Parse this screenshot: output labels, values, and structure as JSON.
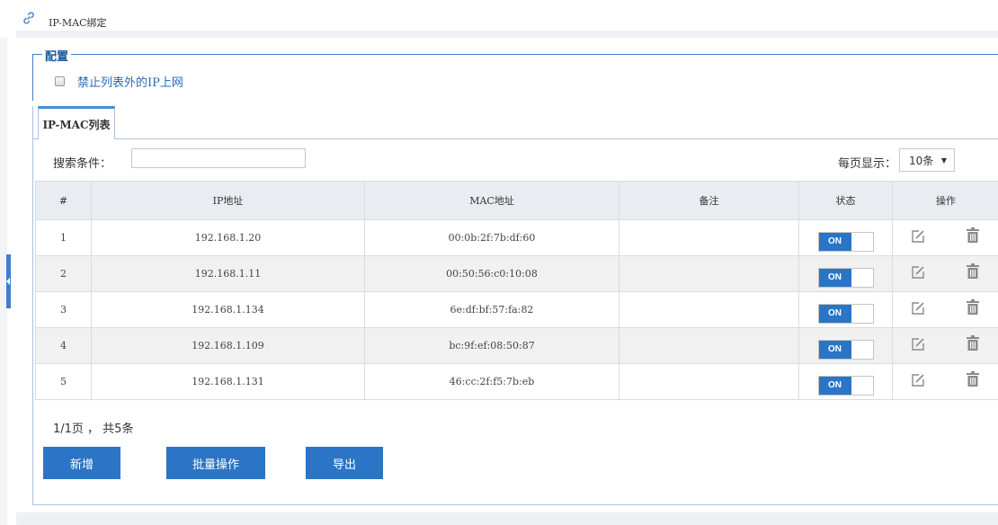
{
  "header": {
    "title": "IP-MAC绑定",
    "icon": "link-icon"
  },
  "config": {
    "legend": "配置",
    "checkbox_label": "禁止列表外的IP上网",
    "checked": false
  },
  "tab": {
    "label": "IP-MAC列表"
  },
  "search": {
    "label": "搜索条件：",
    "value": ""
  },
  "per_page": {
    "label": "每页显示：",
    "selected": "10条"
  },
  "table": {
    "headers": [
      "#",
      "IP地址",
      "MAC地址",
      "备注",
      "状态",
      "操作"
    ],
    "rows": [
      {
        "index": "1",
        "ip": "192.168.1.20",
        "mac": "00:0b:2f:7b:df:60",
        "note": "",
        "status": "ON"
      },
      {
        "index": "2",
        "ip": "192.168.1.11",
        "mac": "00:50:56:c0:10:08",
        "note": "",
        "status": "ON"
      },
      {
        "index": "3",
        "ip": "192.168.1.134",
        "mac": "6e:df:bf:57:fa:82",
        "note": "",
        "status": "ON"
      },
      {
        "index": "4",
        "ip": "192.168.1.109",
        "mac": "bc:9f:ef:08:50:87",
        "note": "",
        "status": "ON"
      },
      {
        "index": "5",
        "ip": "192.168.1.131",
        "mac": "46:cc:2f:f5:7b:eb",
        "note": "",
        "status": "ON"
      }
    ]
  },
  "pagination": {
    "text": "1/1页 ， 共5条"
  },
  "buttons": {
    "add": "新增",
    "batch": "批量操作",
    "export": "导出"
  },
  "colors": {
    "accent": "#2a75c5",
    "header_bg": "#e9edf2",
    "stripe": "#f1f1f1"
  }
}
